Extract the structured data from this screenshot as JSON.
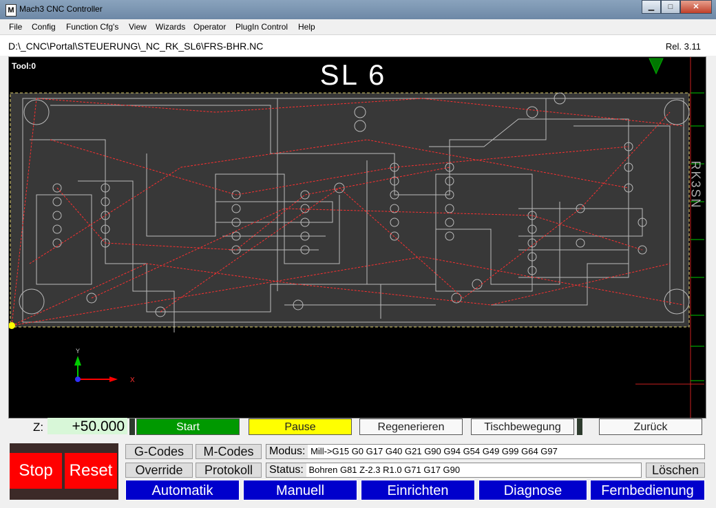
{
  "window": {
    "title": "Mach3 CNC Controller",
    "icon": "mach3-icon"
  },
  "menu": [
    "File",
    "Config",
    "Function Cfg's",
    "View",
    "Wizards",
    "Operator",
    "PlugIn Control",
    "Help"
  ],
  "file": {
    "path": "D:\\_CNC\\Portal\\STEUERUNG\\_NC_RK_SL6\\FRS-BHR.NC",
    "release": "Rel. 3.11"
  },
  "toolpath": {
    "tool_label": "Tool:0",
    "title": "SL 6",
    "board_text": "RK3SN"
  },
  "controls": {
    "z_label": "Z:",
    "z_value": "+50.000",
    "start": "Start",
    "pause": "Pause",
    "regenerate": "Regenerieren",
    "table_move": "Tischbewegung",
    "back": "Zurück"
  },
  "left": {
    "stop": "Stop",
    "reset": "Reset"
  },
  "buttons": {
    "gcodes": "G-Codes",
    "mcodes": "M-Codes",
    "override": "Override",
    "protocol": "Protokoll",
    "clear": "Löschen"
  },
  "modus": {
    "label": "Modus:",
    "value": "Mill->G15  G0 G17 G40 G21 G90 G94 G54 G49 G99 G64 G97"
  },
  "status": {
    "label": "Status:",
    "value": "Bohren  G81  Z-2.3  R1.0     G71   G17   G90"
  },
  "nav": [
    "Automatik",
    "Manuell",
    "Einrichten",
    "Diagnose",
    "Fernbedienung"
  ],
  "colors": {
    "start": "#009900",
    "pause": "#ffff00",
    "stop": "#ff0000",
    "nav": "#0000cc",
    "trace": "#bbbbbb",
    "rapid": "#ff3030"
  }
}
